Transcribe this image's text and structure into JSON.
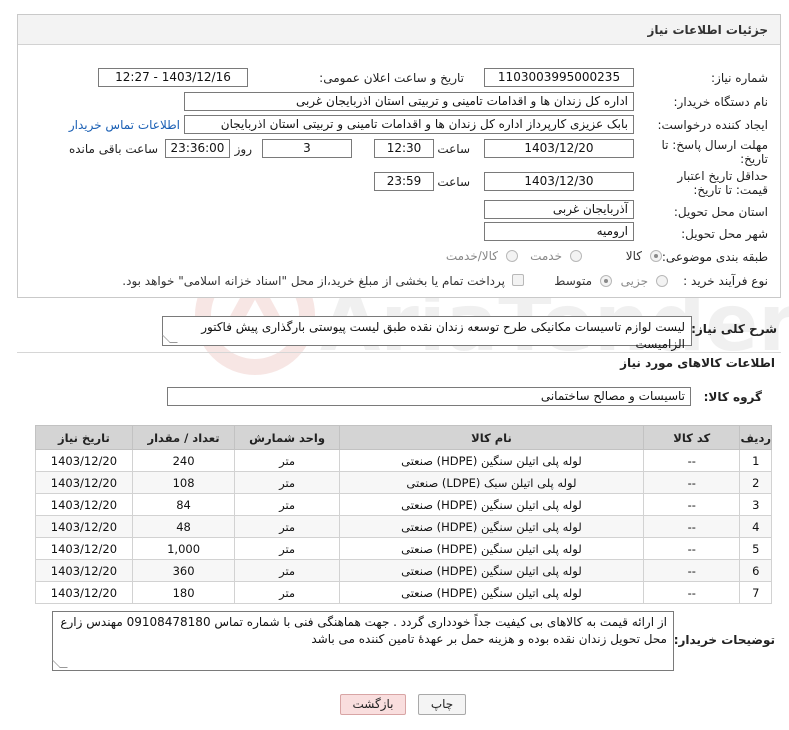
{
  "panel_title": "جزئیات اطلاعات نیاز",
  "fields": {
    "need_number_label": "شماره نیاز:",
    "need_number": "1103003995000235",
    "announce_label": "تاریخ و ساعت اعلان عمومی:",
    "announce_value": "1403/12/16 - 12:27",
    "buyer_org_label": "نام دستگاه خریدار:",
    "buyer_org": "اداره کل زندان ها و اقدامات تامینی و تربیتی استان اذربایجان غربی",
    "creator_label": "ایجاد کننده درخواست:",
    "creator": "بابک عزیزی کارپرداز اداره کل زندان ها و اقدامات تامینی و تربیتی استان اذربایجان",
    "contact_link": "اطلاعات تماس خریدار",
    "deadline_label": "مهلت ارسال پاسخ: تا تاریخ:",
    "deadline_date": "1403/12/20",
    "time_label": "ساعت",
    "deadline_time": "12:30",
    "days_value": "3",
    "days_label": "روز و",
    "remaining_time": "23:36:00",
    "remaining_label": "ساعت باقی مانده",
    "validity_label": "حداقل تاریخ اعتبار قیمت: تا تاریخ:",
    "validity_date": "1403/12/30",
    "validity_time": "23:59",
    "province_label": "استان محل تحویل:",
    "province": "آذربایجان غربی",
    "city_label": "شهر محل تحویل:",
    "city": "ارومیه",
    "category_label": "طبقه بندی موضوعی:",
    "category_options": [
      "کالا",
      "خدمت",
      "کالا/خدمت"
    ],
    "process_label": "نوع فرآیند خرید :",
    "process_options": [
      "جزیی",
      "متوسط"
    ],
    "payment_note": "پرداخت تمام یا بخشی از مبلغ خرید،از محل \"اسناد خزانه اسلامی\" خواهد بود."
  },
  "description": {
    "label": "شرح کلی نیاز:",
    "text": "لیست لوازم تاسیسات  مکانیکی طرح توسعه زندان نقده طبق لیست پیوستی بارگذاری پیش فاکتور الزامیست"
  },
  "goods_info_title": "اطلاعات کالاهای مورد نیاز",
  "goods_group": {
    "label": "گروه کالا:",
    "value": "تاسیسات و مصالح ساختمانی"
  },
  "table": {
    "headers": [
      "ردیف",
      "کد کالا",
      "نام کالا",
      "واحد شمارش",
      "تعداد / مقدار",
      "تاریخ نیاز"
    ],
    "rows": [
      [
        "1",
        "--",
        "لوله پلی اتیلن سنگین (HDPE) صنعتی",
        "متر",
        "240",
        "1403/12/20"
      ],
      [
        "2",
        "--",
        "لوله پلی اتیلن سبک (LDPE) صنعتی",
        "متر",
        "108",
        "1403/12/20"
      ],
      [
        "3",
        "--",
        "لوله پلی اتیلن سنگین (HDPE) صنعتی",
        "متر",
        "84",
        "1403/12/20"
      ],
      [
        "4",
        "--",
        "لوله پلی اتیلن سنگین (HDPE) صنعتی",
        "متر",
        "48",
        "1403/12/20"
      ],
      [
        "5",
        "--",
        "لوله پلی اتیلن سنگین (HDPE) صنعتی",
        "متر",
        "1,000",
        "1403/12/20"
      ],
      [
        "6",
        "--",
        "لوله پلی اتیلن سنگین (HDPE) صنعتی",
        "متر",
        "360",
        "1403/12/20"
      ],
      [
        "7",
        "--",
        "لوله پلی اتیلن سنگین (HDPE) صنعتی",
        "متر",
        "180",
        "1403/12/20"
      ]
    ]
  },
  "buyer_notes": {
    "label": "توضیحات خریدار:",
    "text": "از ارائه قیمت به کالاهای بی کیفیت جداً خودداری گردد . جهت هماهنگی فنی با شماره تماس 09108478180 مهندس زارع محل تحویل زندان نقده بوده و هزینه حمل بر عهدهٔ تامین کننده می باشد"
  },
  "buttons": {
    "print": "چاپ",
    "back": "بازگشت"
  },
  "watermark_text": "AriaTender.neT"
}
